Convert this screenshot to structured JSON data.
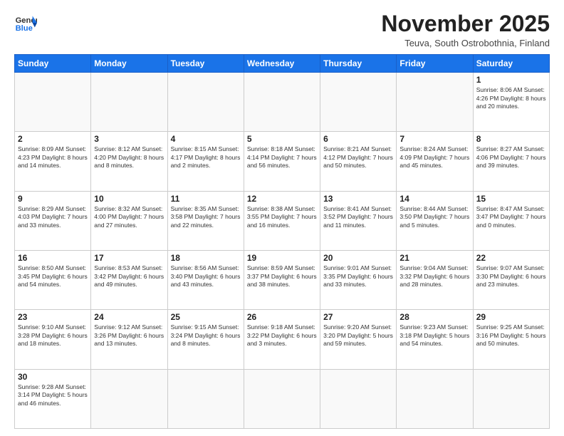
{
  "header": {
    "logo_general": "General",
    "logo_blue": "Blue",
    "month": "November 2025",
    "location": "Teuva, South Ostrobothnia, Finland"
  },
  "weekdays": [
    "Sunday",
    "Monday",
    "Tuesday",
    "Wednesday",
    "Thursday",
    "Friday",
    "Saturday"
  ],
  "weeks": [
    [
      {
        "day": "",
        "info": ""
      },
      {
        "day": "",
        "info": ""
      },
      {
        "day": "",
        "info": ""
      },
      {
        "day": "",
        "info": ""
      },
      {
        "day": "",
        "info": ""
      },
      {
        "day": "",
        "info": ""
      },
      {
        "day": "1",
        "info": "Sunrise: 8:06 AM\nSunset: 4:26 PM\nDaylight: 8 hours\nand 20 minutes."
      }
    ],
    [
      {
        "day": "2",
        "info": "Sunrise: 8:09 AM\nSunset: 4:23 PM\nDaylight: 8 hours\nand 14 minutes."
      },
      {
        "day": "3",
        "info": "Sunrise: 8:12 AM\nSunset: 4:20 PM\nDaylight: 8 hours\nand 8 minutes."
      },
      {
        "day": "4",
        "info": "Sunrise: 8:15 AM\nSunset: 4:17 PM\nDaylight: 8 hours\nand 2 minutes."
      },
      {
        "day": "5",
        "info": "Sunrise: 8:18 AM\nSunset: 4:14 PM\nDaylight: 7 hours\nand 56 minutes."
      },
      {
        "day": "6",
        "info": "Sunrise: 8:21 AM\nSunset: 4:12 PM\nDaylight: 7 hours\nand 50 minutes."
      },
      {
        "day": "7",
        "info": "Sunrise: 8:24 AM\nSunset: 4:09 PM\nDaylight: 7 hours\nand 45 minutes."
      },
      {
        "day": "8",
        "info": "Sunrise: 8:27 AM\nSunset: 4:06 PM\nDaylight: 7 hours\nand 39 minutes."
      }
    ],
    [
      {
        "day": "9",
        "info": "Sunrise: 8:29 AM\nSunset: 4:03 PM\nDaylight: 7 hours\nand 33 minutes."
      },
      {
        "day": "10",
        "info": "Sunrise: 8:32 AM\nSunset: 4:00 PM\nDaylight: 7 hours\nand 27 minutes."
      },
      {
        "day": "11",
        "info": "Sunrise: 8:35 AM\nSunset: 3:58 PM\nDaylight: 7 hours\nand 22 minutes."
      },
      {
        "day": "12",
        "info": "Sunrise: 8:38 AM\nSunset: 3:55 PM\nDaylight: 7 hours\nand 16 minutes."
      },
      {
        "day": "13",
        "info": "Sunrise: 8:41 AM\nSunset: 3:52 PM\nDaylight: 7 hours\nand 11 minutes."
      },
      {
        "day": "14",
        "info": "Sunrise: 8:44 AM\nSunset: 3:50 PM\nDaylight: 7 hours\nand 5 minutes."
      },
      {
        "day": "15",
        "info": "Sunrise: 8:47 AM\nSunset: 3:47 PM\nDaylight: 7 hours\nand 0 minutes."
      }
    ],
    [
      {
        "day": "16",
        "info": "Sunrise: 8:50 AM\nSunset: 3:45 PM\nDaylight: 6 hours\nand 54 minutes."
      },
      {
        "day": "17",
        "info": "Sunrise: 8:53 AM\nSunset: 3:42 PM\nDaylight: 6 hours\nand 49 minutes."
      },
      {
        "day": "18",
        "info": "Sunrise: 8:56 AM\nSunset: 3:40 PM\nDaylight: 6 hours\nand 43 minutes."
      },
      {
        "day": "19",
        "info": "Sunrise: 8:59 AM\nSunset: 3:37 PM\nDaylight: 6 hours\nand 38 minutes."
      },
      {
        "day": "20",
        "info": "Sunrise: 9:01 AM\nSunset: 3:35 PM\nDaylight: 6 hours\nand 33 minutes."
      },
      {
        "day": "21",
        "info": "Sunrise: 9:04 AM\nSunset: 3:32 PM\nDaylight: 6 hours\nand 28 minutes."
      },
      {
        "day": "22",
        "info": "Sunrise: 9:07 AM\nSunset: 3:30 PM\nDaylight: 6 hours\nand 23 minutes."
      }
    ],
    [
      {
        "day": "23",
        "info": "Sunrise: 9:10 AM\nSunset: 3:28 PM\nDaylight: 6 hours\nand 18 minutes."
      },
      {
        "day": "24",
        "info": "Sunrise: 9:12 AM\nSunset: 3:26 PM\nDaylight: 6 hours\nand 13 minutes."
      },
      {
        "day": "25",
        "info": "Sunrise: 9:15 AM\nSunset: 3:24 PM\nDaylight: 6 hours\nand 8 minutes."
      },
      {
        "day": "26",
        "info": "Sunrise: 9:18 AM\nSunset: 3:22 PM\nDaylight: 6 hours\nand 3 minutes."
      },
      {
        "day": "27",
        "info": "Sunrise: 9:20 AM\nSunset: 3:20 PM\nDaylight: 5 hours\nand 59 minutes."
      },
      {
        "day": "28",
        "info": "Sunrise: 9:23 AM\nSunset: 3:18 PM\nDaylight: 5 hours\nand 54 minutes."
      },
      {
        "day": "29",
        "info": "Sunrise: 9:25 AM\nSunset: 3:16 PM\nDaylight: 5 hours\nand 50 minutes."
      }
    ],
    [
      {
        "day": "30",
        "info": "Sunrise: 9:28 AM\nSunset: 3:14 PM\nDaylight: 5 hours\nand 46 minutes."
      },
      {
        "day": "",
        "info": ""
      },
      {
        "day": "",
        "info": ""
      },
      {
        "day": "",
        "info": ""
      },
      {
        "day": "",
        "info": ""
      },
      {
        "day": "",
        "info": ""
      },
      {
        "day": "",
        "info": ""
      }
    ]
  ]
}
